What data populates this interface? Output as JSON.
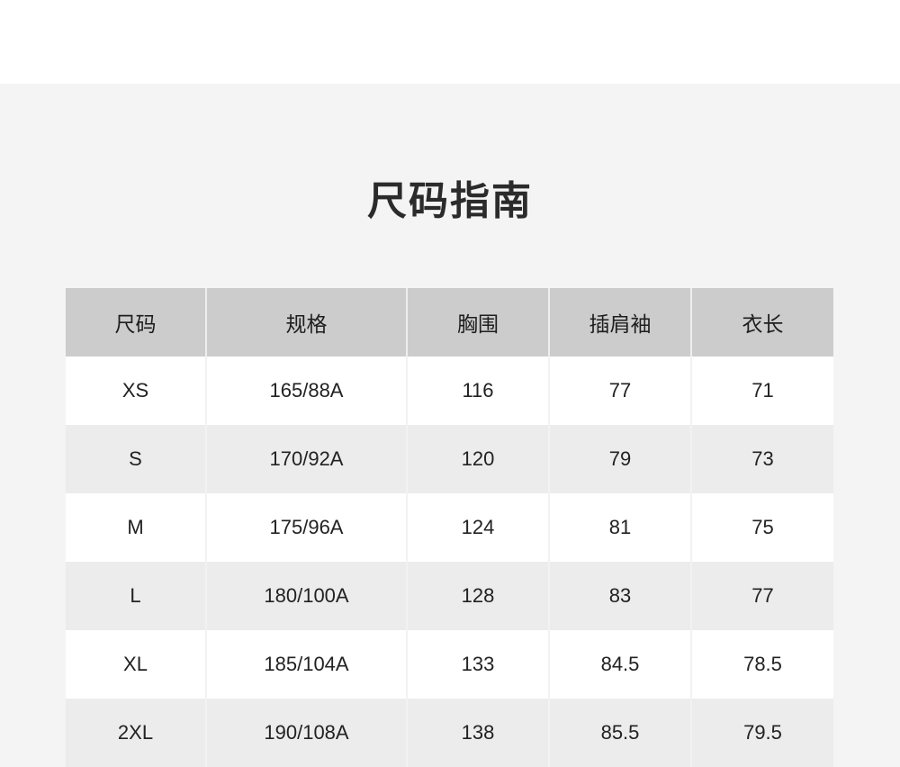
{
  "page": {
    "title": "尺码指南"
  },
  "table": {
    "headers": [
      "尺码",
      "规格",
      "胸围",
      "插肩袖",
      "衣长"
    ],
    "rows": [
      [
        "XS",
        "165/88A",
        "116",
        "77",
        "71"
      ],
      [
        "S",
        "170/92A",
        "120",
        "79",
        "73"
      ],
      [
        "M",
        "175/96A",
        "124",
        "81",
        "75"
      ],
      [
        "L",
        "180/100A",
        "128",
        "83",
        "77"
      ],
      [
        "XL",
        "185/104A",
        "133",
        "84.5",
        "78.5"
      ],
      [
        "2XL",
        "190/108A",
        "138",
        "85.5",
        "79.5"
      ]
    ]
  },
  "colors": {
    "panel_bg": "#f4f4f4",
    "header_bg": "#cccccc",
    "row_alt_bg": "#ececec",
    "text": "#222222"
  }
}
